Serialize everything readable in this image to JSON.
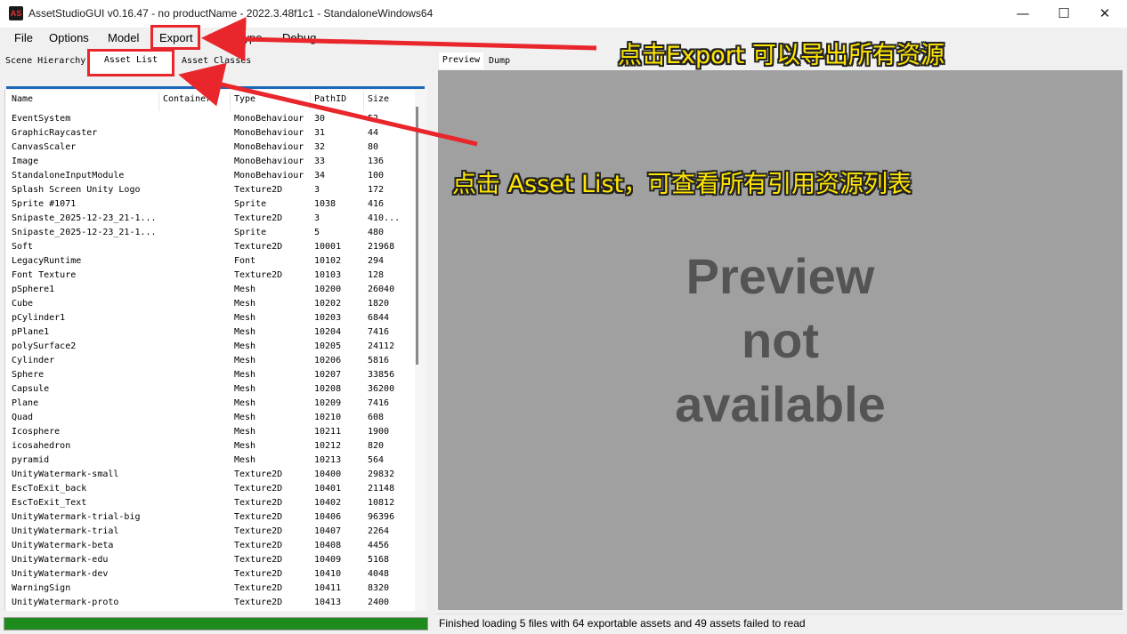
{
  "window": {
    "title": "AssetStudioGUI v0.16.47 - no productName - 2022.3.48f1c1 - StandaloneWindows64",
    "app_icon_label": "AS",
    "minimize": "—",
    "maximize": "☐",
    "close": "✕"
  },
  "menu": {
    "file": "File",
    "options": "Options",
    "model": "Model",
    "export": "Export",
    "filter_type": "Filter Type",
    "debug": "Debug"
  },
  "left_tabs": {
    "scene_hierarchy": "Scene Hierarchy",
    "asset_list": "Asset List",
    "asset_classes": "Asset Classes"
  },
  "right_tabs": {
    "preview": "Preview",
    "dump": "Dump"
  },
  "columns": [
    "Name",
    "Container",
    "Type",
    "PathID",
    "Size"
  ],
  "assets": [
    {
      "name": "EventSystem",
      "type": "MonoBehaviour",
      "path": "30",
      "size": "52"
    },
    {
      "name": "GraphicRaycaster",
      "type": "MonoBehaviour",
      "path": "31",
      "size": "44"
    },
    {
      "name": "CanvasScaler",
      "type": "MonoBehaviour",
      "path": "32",
      "size": "80"
    },
    {
      "name": "Image",
      "type": "MonoBehaviour",
      "path": "33",
      "size": "136"
    },
    {
      "name": "StandaloneInputModule",
      "type": "MonoBehaviour",
      "path": "34",
      "size": "100"
    },
    {
      "name": "Splash Screen Unity Logo",
      "type": "Texture2D",
      "path": "3",
      "size": "172"
    },
    {
      "name": "Sprite #1071",
      "type": "Sprite",
      "path": "1038",
      "size": "416"
    },
    {
      "name": "Snipaste_2025-12-23_21-1...",
      "type": "Texture2D",
      "path": "3",
      "size": "410..."
    },
    {
      "name": "Snipaste_2025-12-23_21-1...",
      "type": "Sprite",
      "path": "5",
      "size": "480"
    },
    {
      "name": "Soft",
      "type": "Texture2D",
      "path": "10001",
      "size": "21968"
    },
    {
      "name": "LegacyRuntime",
      "type": "Font",
      "path": "10102",
      "size": "294"
    },
    {
      "name": "Font Texture",
      "type": "Texture2D",
      "path": "10103",
      "size": "128"
    },
    {
      "name": "pSphere1",
      "type": "Mesh",
      "path": "10200",
      "size": "26040"
    },
    {
      "name": "Cube",
      "type": "Mesh",
      "path": "10202",
      "size": "1820"
    },
    {
      "name": "pCylinder1",
      "type": "Mesh",
      "path": "10203",
      "size": "6844"
    },
    {
      "name": "pPlane1",
      "type": "Mesh",
      "path": "10204",
      "size": "7416"
    },
    {
      "name": "polySurface2",
      "type": "Mesh",
      "path": "10205",
      "size": "24112"
    },
    {
      "name": "Cylinder",
      "type": "Mesh",
      "path": "10206",
      "size": "5816"
    },
    {
      "name": "Sphere",
      "type": "Mesh",
      "path": "10207",
      "size": "33856"
    },
    {
      "name": "Capsule",
      "type": "Mesh",
      "path": "10208",
      "size": "36200"
    },
    {
      "name": "Plane",
      "type": "Mesh",
      "path": "10209",
      "size": "7416"
    },
    {
      "name": "Quad",
      "type": "Mesh",
      "path": "10210",
      "size": "608"
    },
    {
      "name": "Icosphere",
      "type": "Mesh",
      "path": "10211",
      "size": "1900"
    },
    {
      "name": "icosahedron",
      "type": "Mesh",
      "path": "10212",
      "size": "820"
    },
    {
      "name": "pyramid",
      "type": "Mesh",
      "path": "10213",
      "size": "564"
    },
    {
      "name": "UnityWatermark-small",
      "type": "Texture2D",
      "path": "10400",
      "size": "29832"
    },
    {
      "name": "EscToExit_back",
      "type": "Texture2D",
      "path": "10401",
      "size": "21148"
    },
    {
      "name": "EscToExit_Text",
      "type": "Texture2D",
      "path": "10402",
      "size": "10812"
    },
    {
      "name": "UnityWatermark-trial-big",
      "type": "Texture2D",
      "path": "10406",
      "size": "96396"
    },
    {
      "name": "UnityWatermark-trial",
      "type": "Texture2D",
      "path": "10407",
      "size": "2264"
    },
    {
      "name": "UnityWatermark-beta",
      "type": "Texture2D",
      "path": "10408",
      "size": "4456"
    },
    {
      "name": "UnityWatermark-edu",
      "type": "Texture2D",
      "path": "10409",
      "size": "5168"
    },
    {
      "name": "UnityWatermark-dev",
      "type": "Texture2D",
      "path": "10410",
      "size": "4048"
    },
    {
      "name": "WarningSign",
      "type": "Texture2D",
      "path": "10411",
      "size": "8320"
    },
    {
      "name": "UnityWatermark-proto",
      "type": "Texture2D",
      "path": "10413",
      "size": "2400"
    }
  ],
  "preview": {
    "line1": "Preview",
    "line2": "not",
    "line3": "available"
  },
  "status": "Finished loading 5 files with 64 exportable assets and 49 assets failed to read",
  "progress_percent": 100,
  "annotations": {
    "export_note": "点击Export 可以导出所有资源",
    "assetlist_note": "点击 Asset List，可查看所有引用资源列表"
  },
  "colors": {
    "annotation_text": "#ffe500",
    "annotation_red": "#e8262c",
    "progress_green": "#1e8a1e",
    "preview_bg": "#a0a0a0",
    "tab_accent": "#1b66b8"
  }
}
